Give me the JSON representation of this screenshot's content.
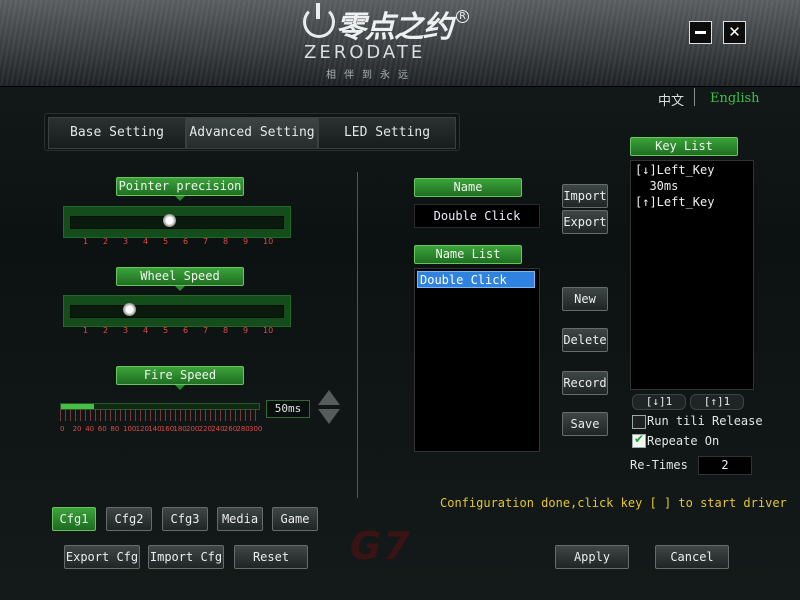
{
  "header": {
    "logo_cn": "零点之约",
    "logo_reg": "R",
    "logo_en": "ZERODATE",
    "slogan": "相伴到永远",
    "minimize_icon": "minimize-icon",
    "close_label": "✕"
  },
  "language": {
    "cn": "中文",
    "en": "English",
    "active": "English"
  },
  "tabs": [
    "Base Setting",
    "Advanced Setting",
    "LED Setting"
  ],
  "active_tab": "Advanced Setting",
  "pointer_precision": {
    "label": "Pointer precision",
    "value": 5,
    "ticks": [
      "1",
      "2",
      "3",
      "4",
      "5",
      "6",
      "7",
      "8",
      "9",
      "10"
    ]
  },
  "wheel_speed": {
    "label": "Wheel Speed",
    "value": 3,
    "ticks": [
      "1",
      "2",
      "3",
      "4",
      "5",
      "6",
      "7",
      "8",
      "9",
      "10"
    ]
  },
  "fire_speed": {
    "label": "Fire Speed",
    "value_text": "50ms",
    "value_ms": 50,
    "max_ms": 300,
    "ticks": [
      "0",
      "20",
      "40",
      "60",
      "80",
      "100",
      "120",
      "140",
      "160",
      "180",
      "200",
      "220",
      "240",
      "260",
      "280",
      "300"
    ]
  },
  "macro": {
    "name_label": "Name",
    "name_value": "Double Click",
    "name_list_label": "Name List",
    "name_list_items": [
      "Double Click"
    ],
    "selected_item": "Double Click",
    "buttons": {
      "import": "Import",
      "export": "Export",
      "new": "New",
      "delete": "Delete",
      "record": "Record",
      "save": "Save"
    }
  },
  "key_list": {
    "label": "Key List",
    "entries": [
      "[↓]Left_Key",
      "  30ms",
      "[↑]Left_Key"
    ],
    "down_btn": "[↓]1",
    "up_btn": "[↑]1"
  },
  "options": {
    "run_till_release": "Run tili Release",
    "run_till_release_checked": false,
    "repeat_on": "Repeate On",
    "repeat_on_checked": true,
    "retimes_label": "Re-Times",
    "retimes_value": "2"
  },
  "status_text": "Configuration done,click key [ ] to start driver",
  "config_tabs": [
    "Cfg1",
    "Cfg2",
    "Cfg3",
    "Media",
    "Game"
  ],
  "active_config": "Cfg1",
  "bottom": {
    "export_cfg": "Export Cfg",
    "import_cfg": "Import Cfg",
    "reset": "Reset",
    "apply": "Apply",
    "cancel": "Cancel"
  },
  "watermark": "G7",
  "colors": {
    "accent_green": "#2f9a30",
    "active_lang": "#39c24a",
    "status_yellow": "#e5c533",
    "tick_red": "#e04848",
    "selection_blue": "#2f82e0"
  }
}
